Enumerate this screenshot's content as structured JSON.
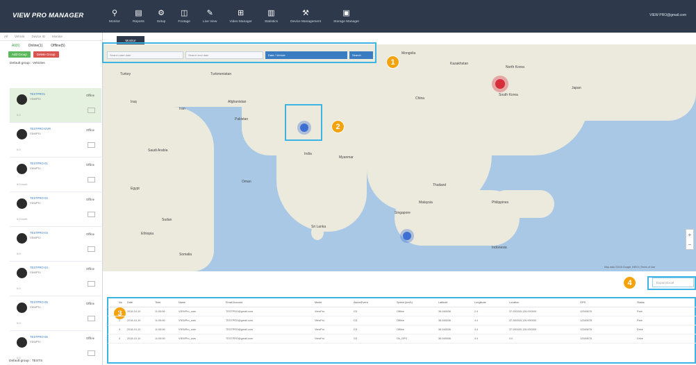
{
  "app": {
    "brand": "VIEW PRO MANAGER",
    "user": "VIEW PRO@gmail.com"
  },
  "nav": [
    {
      "icon": "map-pin-icon",
      "glyph": "⚲",
      "label": "Monitor"
    },
    {
      "icon": "report-icon",
      "glyph": "▤",
      "label": "Reports"
    },
    {
      "icon": "gear-icon",
      "glyph": "⚙",
      "label": "Setup"
    },
    {
      "icon": "camera-icon",
      "glyph": "◫",
      "label": "Footage"
    },
    {
      "icon": "wrench-icon",
      "glyph": "✎",
      "label": "Live View"
    },
    {
      "icon": "playback-icon",
      "glyph": "⊞",
      "label": "Video Manager"
    },
    {
      "icon": "chart-icon",
      "glyph": "▥",
      "label": "Statistics"
    },
    {
      "icon": "device-settings-icon",
      "glyph": "⚒",
      "label": "Device Management"
    },
    {
      "icon": "storage-icon",
      "glyph": "▣",
      "label": "Storage Manager"
    }
  ],
  "sidebar": {
    "tabs": [
      "All",
      "Vehicle",
      "Device ID",
      "Monitor"
    ],
    "filters": [
      "All(6)",
      "Online(1)",
      "Offline(5)"
    ],
    "add_label": "Add Group",
    "delete_label": "Delete Group",
    "group_title": "Default group : Vehicles",
    "footer": "Default group : TESTS",
    "vehicles": [
      {
        "name": "TESTPRO1",
        "model": "ViewPro",
        "status": "Offline",
        "speed": "0.0",
        "selected": true
      },
      {
        "name": "TESTPRO-DVR",
        "model": "ViewPro",
        "status": "Offline",
        "speed": "0.0"
      },
      {
        "name": "TESTPRO-01",
        "model": "ViewPro",
        "status": "Offline",
        "speed": "0.0 km/h"
      },
      {
        "name": "TESTPRO-02",
        "model": "ViewPro",
        "status": "Offline",
        "speed": "0.0 km/h"
      },
      {
        "name": "TESTPRO-03",
        "model": "ViewPro",
        "status": "Offline",
        "speed": "0.0"
      },
      {
        "name": "TESTPRO-04",
        "model": "ViewPro",
        "status": "Offline",
        "speed": "0.0"
      },
      {
        "name": "TESTPRO-05",
        "model": "ViewPro",
        "status": "Offline",
        "speed": "0.0"
      },
      {
        "name": "TESTPRO-06",
        "model": "ViewPro",
        "status": "Offline",
        "speed": "0.0"
      }
    ]
  },
  "map": {
    "tab": "Monitor",
    "from_placeholder": "Search start date",
    "to_placeholder": "Search end date",
    "range_btn": "Date / Vehicle",
    "search_btn": "Search",
    "labels": [
      "Turkey",
      "Turkmenistan",
      "Kazakhstan",
      "Afghanistan",
      "Pakistan",
      "Iraq",
      "Iran",
      "Saudi Arabia",
      "Egypt",
      "Sudan",
      "Ethiopia",
      "Somalia",
      "Oman",
      "India",
      "China",
      "Myanmar",
      "Thailand",
      "Malaysia",
      "Indonesia",
      "Philippines",
      "South Korea",
      "North Korea",
      "Japan",
      "Sri Lanka",
      "Singapore",
      "Mongolia"
    ],
    "credit": "Map data ©2018 Google, INEGI | Terms of Use"
  },
  "badges": [
    "1",
    "2",
    "3",
    "4"
  ],
  "export_label": "Export Excel",
  "table": {
    "headers": [
      "No",
      "Date",
      "Time",
      "Name",
      "Email Account",
      "Model",
      "Alarm/Event",
      "Speed (km/h)",
      "Latitude",
      "Longitude",
      "Location",
      "GPS",
      "Status"
    ],
    "rows": [
      [
        "1",
        "2018-10-10",
        "11:05:06",
        "VIEWPro_cars",
        "TESTPRO@gmail.com",
        "ViewPro",
        "G3",
        "Offline",
        "36.048536",
        "2.4",
        "37.000000,126.000000",
        "12345678",
        "Park"
      ],
      [
        "2",
        "2018-10-10",
        "11:05:06",
        "VIEWPro_cars",
        "TESTPRO@gmail.com",
        "ViewPro",
        "G3",
        "Offline",
        "36.048536",
        "4.4",
        "37.000000,126.000000",
        "12345678",
        "Park"
      ],
      [
        "3",
        "2018-10-10",
        "11:05:06",
        "VIEWPro_cars",
        "TESTPRO@gmail.com",
        "ViewPro",
        "G3",
        "Offline",
        "36.048536",
        "4.4",
        "37.000000,126.000000",
        "12345678",
        "Drive"
      ],
      [
        "4",
        "2018-10-10",
        "11:05:06",
        "VIEWPro_cars",
        "TESTPRO@gmail.com",
        "ViewPro",
        "G3",
        "Ok_GPS",
        "36.048536",
        "4.4",
        "0.0",
        "12345678",
        "Drive"
      ]
    ]
  }
}
